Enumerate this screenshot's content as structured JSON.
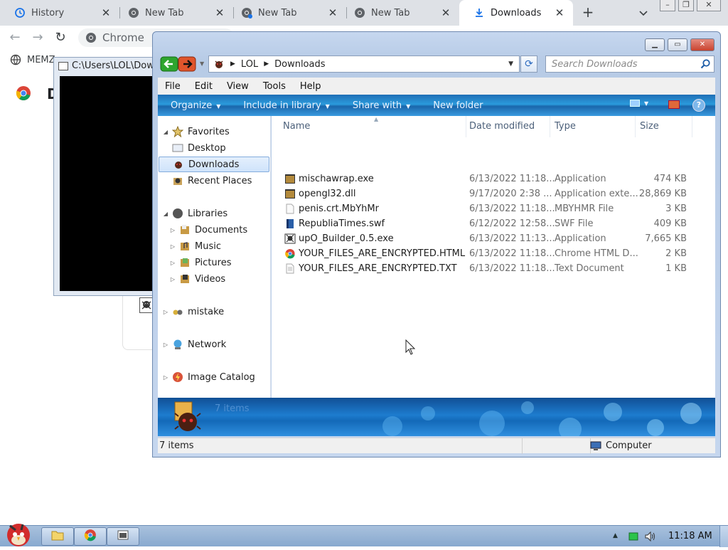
{
  "browser": {
    "tabs": [
      {
        "label": "History",
        "icon": "history-icon"
      },
      {
        "label": "New Tab",
        "icon": "chrome-icon"
      },
      {
        "label": "New Tab",
        "icon": "chrome-icon"
      },
      {
        "label": "New Tab",
        "icon": "chrome-icon"
      },
      {
        "label": "Downloads",
        "icon": "download-icon",
        "active": true
      }
    ],
    "omnibox_text": "Chrome",
    "bookmark_label": "MEMZ",
    "page_heading": "D"
  },
  "console": {
    "title": "C:\\Users\\LOL\\Downloads"
  },
  "explorer": {
    "breadcrumb": [
      "LOL",
      "Downloads"
    ],
    "search_placeholder": "Search Downloads",
    "menu": [
      "File",
      "Edit",
      "View",
      "Tools",
      "Help"
    ],
    "commands": [
      {
        "label": "Organize",
        "dropdown": true
      },
      {
        "label": "Include in library",
        "dropdown": true
      },
      {
        "label": "Share with",
        "dropdown": true
      },
      {
        "label": "New folder",
        "dropdown": false
      }
    ],
    "nav": {
      "favorites": "Favorites",
      "desktop": "Desktop",
      "downloads": "Downloads",
      "recent": "Recent Places",
      "libraries": "Libraries",
      "documents": "Documents",
      "music": "Music",
      "pictures": "Pictures",
      "videos": "Videos",
      "mistake": "mistake",
      "network": "Network",
      "image_catalog": "Image Catalog"
    },
    "columns": {
      "name": "Name",
      "date": "Date modified",
      "type": "Type",
      "size": "Size"
    },
    "files": [
      {
        "name": "mischawrap.exe",
        "date": "6/13/2022 11:18...",
        "type": "Application",
        "size": "474 KB",
        "icon": "app-icon"
      },
      {
        "name": "opengl32.dll",
        "date": "9/17/2020 2:38 ...",
        "type": "Application exte...",
        "size": "28,869 KB",
        "icon": "dll-icon"
      },
      {
        "name": "penis.crt.MbYhMr",
        "date": "6/13/2022 11:18...",
        "type": "MBYHMR File",
        "size": "3 KB",
        "icon": "blank-file-icon"
      },
      {
        "name": "RepubliaTimes.swf",
        "date": "6/12/2022 12:58...",
        "type": "SWF File",
        "size": "409 KB",
        "icon": "swf-icon"
      },
      {
        "name": "upO_Builder_0.5.exe",
        "date": "6/13/2022 11:13...",
        "type": "Application",
        "size": "7,665 KB",
        "icon": "skull-app-icon"
      },
      {
        "name": "YOUR_FILES_ARE_ENCRYPTED.HTML",
        "date": "6/13/2022 11:18...",
        "type": "Chrome HTML D...",
        "size": "2 KB",
        "icon": "chrome-icon"
      },
      {
        "name": "YOUR_FILES_ARE_ENCRYPTED.TXT",
        "date": "6/13/2022 11:18...",
        "type": "Text Document",
        "size": "1 KB",
        "icon": "text-file-icon"
      }
    ],
    "details_count": "7 items",
    "status_count": "7 items",
    "status_location": "Computer"
  },
  "taskbar": {
    "clock": "11:18 AM"
  },
  "colors": {
    "command_bar": "#2b9bdc",
    "details_bar": "#1d7ccf",
    "selection": "#cfe3fb"
  }
}
